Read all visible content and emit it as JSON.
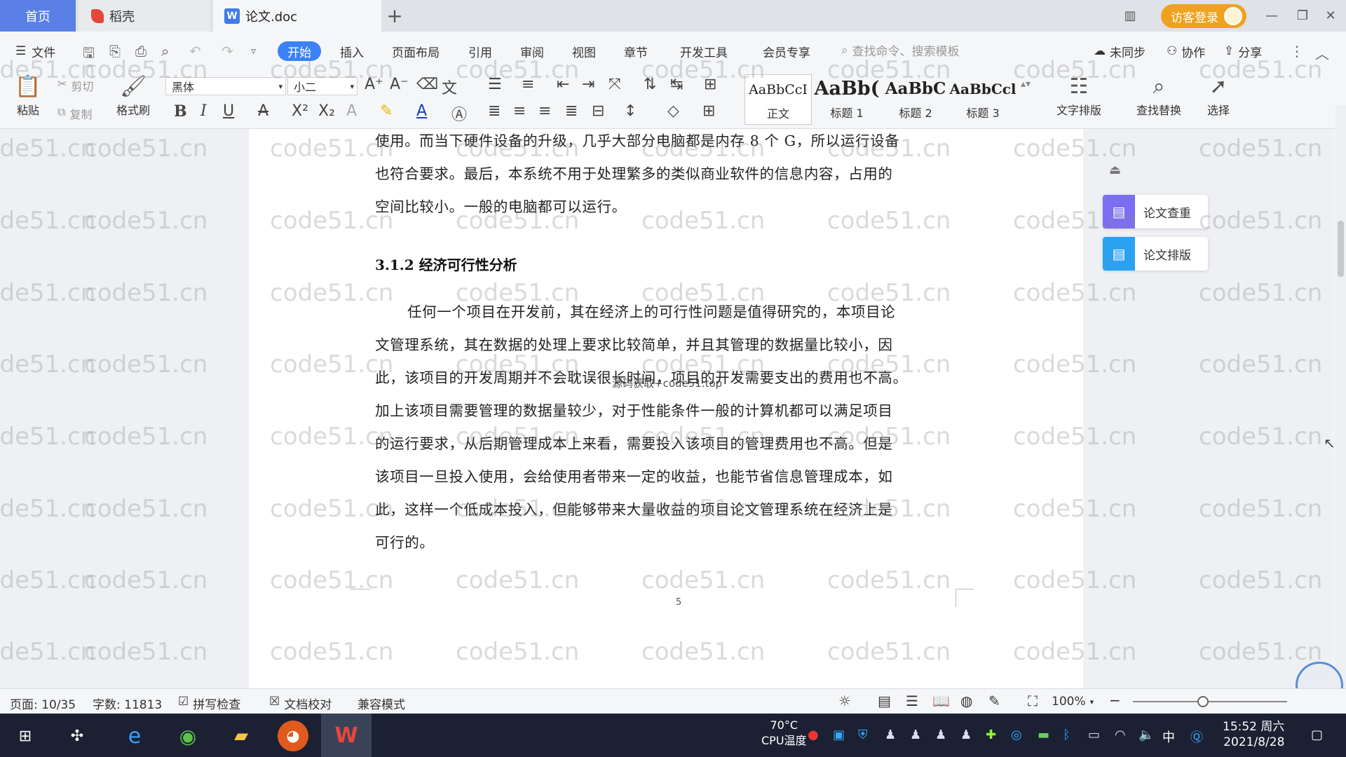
{
  "tabs": {
    "home": "首页",
    "daoke": "稻壳",
    "doc": "论文.doc"
  },
  "login": "访客登录",
  "menu": {
    "file": "文件",
    "items": [
      "开始",
      "插入",
      "页面布局",
      "引用",
      "审阅",
      "视图",
      "章节",
      "开发工具",
      "会员专享"
    ],
    "search_placeholder": "查找命令、搜索模板",
    "sync": "未同步",
    "collab": "协作",
    "share": "分享"
  },
  "ribbon": {
    "paste": "粘贴",
    "cut": "剪切",
    "copy": "复制",
    "format_painter": "格式刷",
    "font_name": "黑体",
    "font_size": "小二",
    "styles": [
      {
        "sample": "AaBbCcI",
        "name": "正文"
      },
      {
        "sample": "AaBb(",
        "name": "标题 1"
      },
      {
        "sample": "AaBbC",
        "name": "标题 2"
      },
      {
        "sample": "AaBbCcl",
        "name": "标题 3"
      }
    ],
    "text_layout": "文字排版",
    "find_replace": "查找替换",
    "select": "选择"
  },
  "document": {
    "para1_lines": [
      "使用。而当下硬件设备的升级，几乎大部分电脑都是内存 8 个 G，所以运行设备",
      "也符合要求。最后，本系统不用于处理繁多的类似商业软件的信息内容，占用的",
      "空间比较小。一般的电脑都可以运行。"
    ],
    "heading": "3.1.2 经济可行性分析",
    "para2_lines": [
      "任何一个项目在开发前，其在经济上的可行性问题是值得研究的，本项目论",
      "文管理系统，其在数据的处理上要求比较简单，并且其管理的数据量比较小，因",
      "此，该项目的开发周期并不会耽误很长时间，项目的开发需要支出的费用也不高。",
      "加上该项目需要管理的数据量较少，对于性能条件一般的计算机都可以满足项目",
      "的运行要求，从后期管理成本上来看，需要投入该项目的管理费用也不高。但是",
      "该项目一旦投入使用，会给使用者带来一定的收益，也能节省信息管理成本，如",
      "此，这样一个低成本投入，但能够带来大量收益的项目论文管理系统在经济上是",
      "可行的。"
    ],
    "page_number": "5",
    "overlay": "源码获取+code51.top"
  },
  "side_panel": {
    "check": "论文查重",
    "layout": "论文排版"
  },
  "watermark": "code51.cn",
  "status": {
    "page": "页面: 10/35",
    "words": "字数: 11813",
    "spell": "拼写检查",
    "proof": "文档校对",
    "compat": "兼容模式",
    "zoom": "100%"
  },
  "taskbar": {
    "cpu_temp": "70°C",
    "cpu_label": "CPU温度",
    "ime": "中",
    "time": "15:52 周六",
    "date": "2021/8/28"
  },
  "colors": {
    "accent": "#3b82f6",
    "login": "#f0a21e",
    "taskbar": "#1b2133"
  }
}
